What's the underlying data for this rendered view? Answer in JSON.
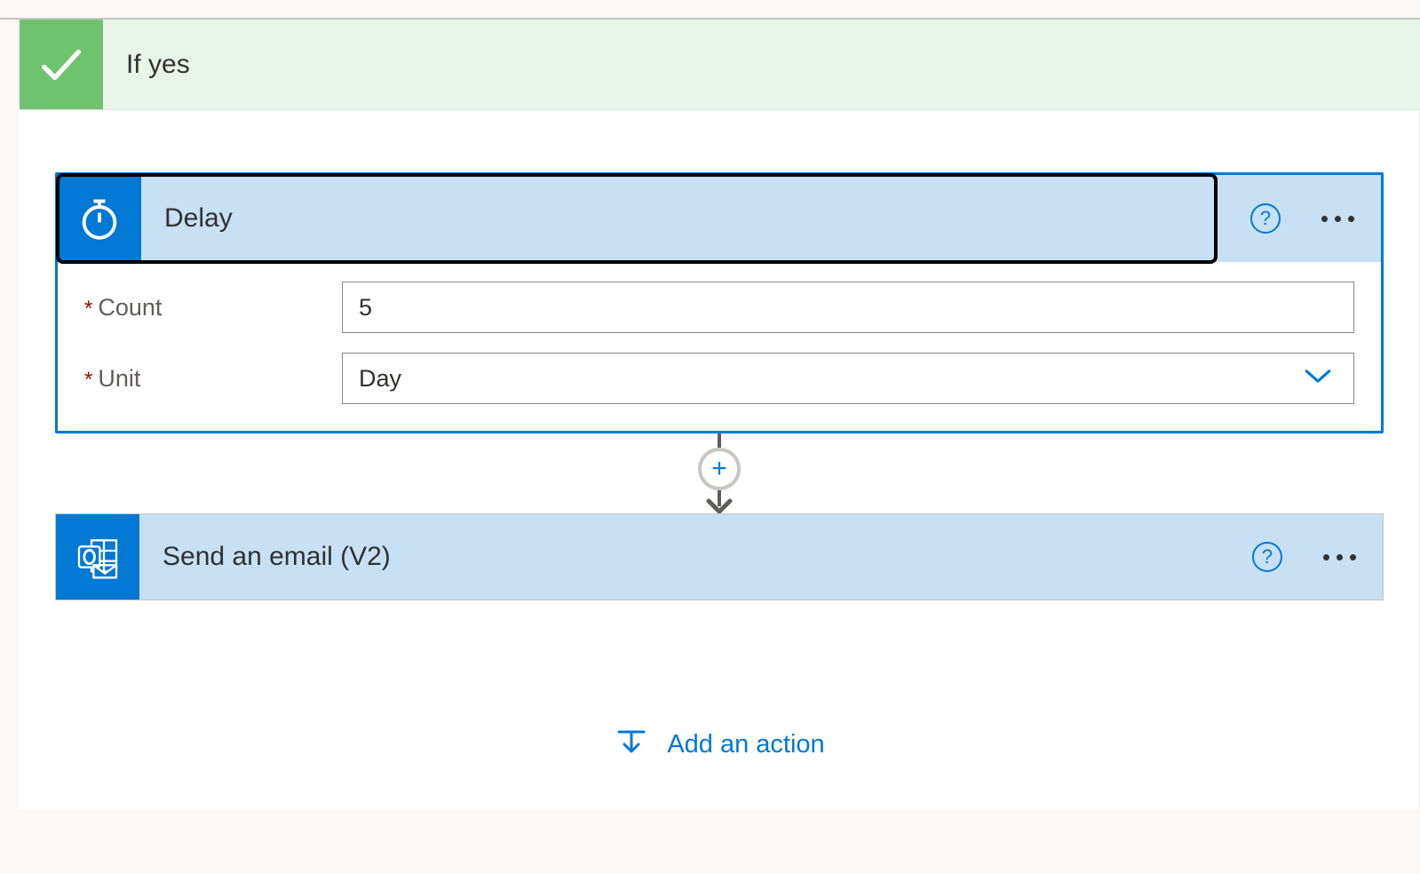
{
  "condition": {
    "title": "If yes"
  },
  "delay": {
    "title": "Delay",
    "fields": {
      "count": {
        "label": "Count",
        "value": "5"
      },
      "unit": {
        "label": "Unit",
        "value": "Day"
      }
    }
  },
  "email": {
    "title": "Send an email (V2)"
  },
  "addAction": {
    "label": "Add an action"
  }
}
